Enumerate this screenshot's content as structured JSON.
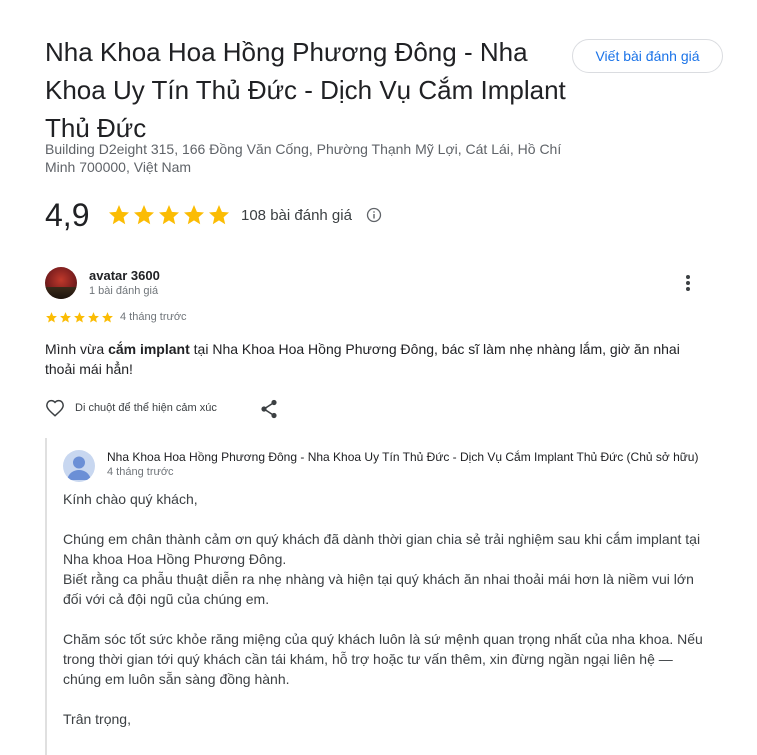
{
  "place": {
    "title": "Nha Khoa Hoa Hồng Phương Đông - Nha Khoa Uy Tín Thủ Đức - Dịch Vụ Cắm Implant Thủ Đức",
    "address": "Building D2eight 315, 166 Đồng Văn Cống, Phường Thạnh Mỹ Lợi, Cát Lái, Hồ Chí Minh 700000, Việt Nam",
    "rating": "4,9",
    "review_count": "108 bài đánh giá",
    "write_review_label": "Viết bài đánh giá",
    "star_color": "#fbbc04"
  },
  "review": {
    "reviewer_name": "avatar 3600",
    "reviewer_meta": "1 bài đánh giá",
    "stars": 5,
    "time": "4 tháng trước",
    "text_before": "Mình vừa ",
    "text_bold": "cắm implant",
    "text_after": " tại Nha Khoa Hoa Hồng Phương Đông, bác sĩ làm nhẹ nhàng lắm, giờ ăn nhai thoải mái hẳn!",
    "react_label": "Di chuột để thể hiện cảm xúc"
  },
  "reply": {
    "owner_name": "Nha Khoa Hoa Hồng Phương Đông - Nha Khoa Uy Tín Thủ Đức - Dịch Vụ Cắm Implant Thủ Đức (Chủ sở hữu)",
    "time": "4 tháng trước",
    "greeting": "Kính chào quý khách,",
    "para1_line1": "Chúng em chân thành cảm ơn quý khách đã dành thời gian chia sẻ trải nghiệm sau khi cắm implant tại Nha khoa Hoa Hồng Phương Đông.",
    "para1_line2": "Biết rằng ca phẫu thuật diễn ra nhẹ nhàng và hiện tại quý khách ăn nhai thoải mái hơn là niềm vui lớn đối với cả đội ngũ của chúng em.",
    "para2": "Chăm sóc tốt sức khỏe răng miệng của quý khách luôn là sứ mệnh quan trọng nhất của nha khoa. Nếu trong thời gian tới quý khách cần tái khám, hỗ trợ hoặc tư vấn thêm, xin đừng ngần ngại liên hệ — chúng em luôn sẵn sàng đồng hành.",
    "closing": "Trân trọng,"
  }
}
